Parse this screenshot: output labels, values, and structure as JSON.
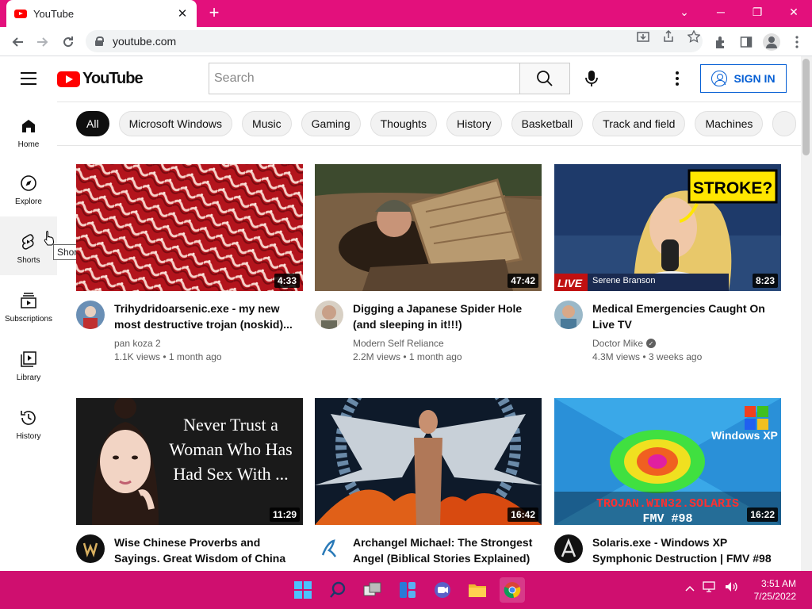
{
  "browser": {
    "tab_title": "YouTube",
    "tab_close": "✕",
    "new_tab": "+",
    "url": "youtube.com",
    "controls": {
      "minimize": "─",
      "maximize": "❐",
      "close": "✕",
      "menu": "⌄"
    }
  },
  "header": {
    "logo_text": "YouTube",
    "search_placeholder": "Search",
    "signin_label": "SIGN IN"
  },
  "chips": [
    "All",
    "Microsoft Windows",
    "Music",
    "Gaming",
    "Thoughts",
    "History",
    "Basketball",
    "Track and field",
    "Machines"
  ],
  "sidebar": {
    "items": [
      {
        "label": "Home"
      },
      {
        "label": "Explore"
      },
      {
        "label": "Shorts"
      },
      {
        "label": "Subscriptions"
      },
      {
        "label": "Library"
      },
      {
        "label": "History"
      }
    ],
    "tooltip": "Shorts"
  },
  "videos": [
    {
      "title": "Trihydridoarsenic.exe - my new most destructive trojan (noskid)...",
      "channel": "pan koza 2",
      "stats": "1.1K views • 1 month ago",
      "duration": "4:33"
    },
    {
      "title": "Digging a Japanese Spider Hole (and sleeping in it!!!)",
      "channel": "Modern Self Reliance",
      "stats": "2.2M views • 1 month ago",
      "duration": "47:42"
    },
    {
      "title": "Medical Emergencies Caught On Live TV",
      "channel": "Doctor Mike",
      "stats": "4.3M views • 3 weeks ago",
      "duration": "8:23",
      "thumb_text": "STROKE?",
      "thumb_live": "LIVE",
      "thumb_name": "Serene Branson"
    },
    {
      "title": "Wise Chinese Proverbs and Sayings. Great Wisdom of China",
      "channel": "",
      "stats": "",
      "duration": "11:29",
      "thumb_text": "Never Trust a Woman Who Has Had Sex With ..."
    },
    {
      "title": "Archangel Michael: The Strongest Angel (Biblical Stories Explained)",
      "channel": "",
      "stats": "",
      "duration": "16:42"
    },
    {
      "title": "Solaris.exe - Windows XP Symphonic Destruction | FMV #98",
      "channel": "",
      "stats": "",
      "duration": "16:22",
      "thumb_text": "TROJAN.WIN32.SOLARIS",
      "thumb_sub": "FMV #98",
      "thumb_brand": "Windows XP"
    }
  ],
  "taskbar": {
    "time": "3:51 AM",
    "date": "7/25/2022"
  },
  "colors": {
    "titlebar": "#e3107c",
    "taskbar": "#cf0f6f",
    "youtube_red": "#ff0000",
    "signin_blue": "#065fd4"
  }
}
